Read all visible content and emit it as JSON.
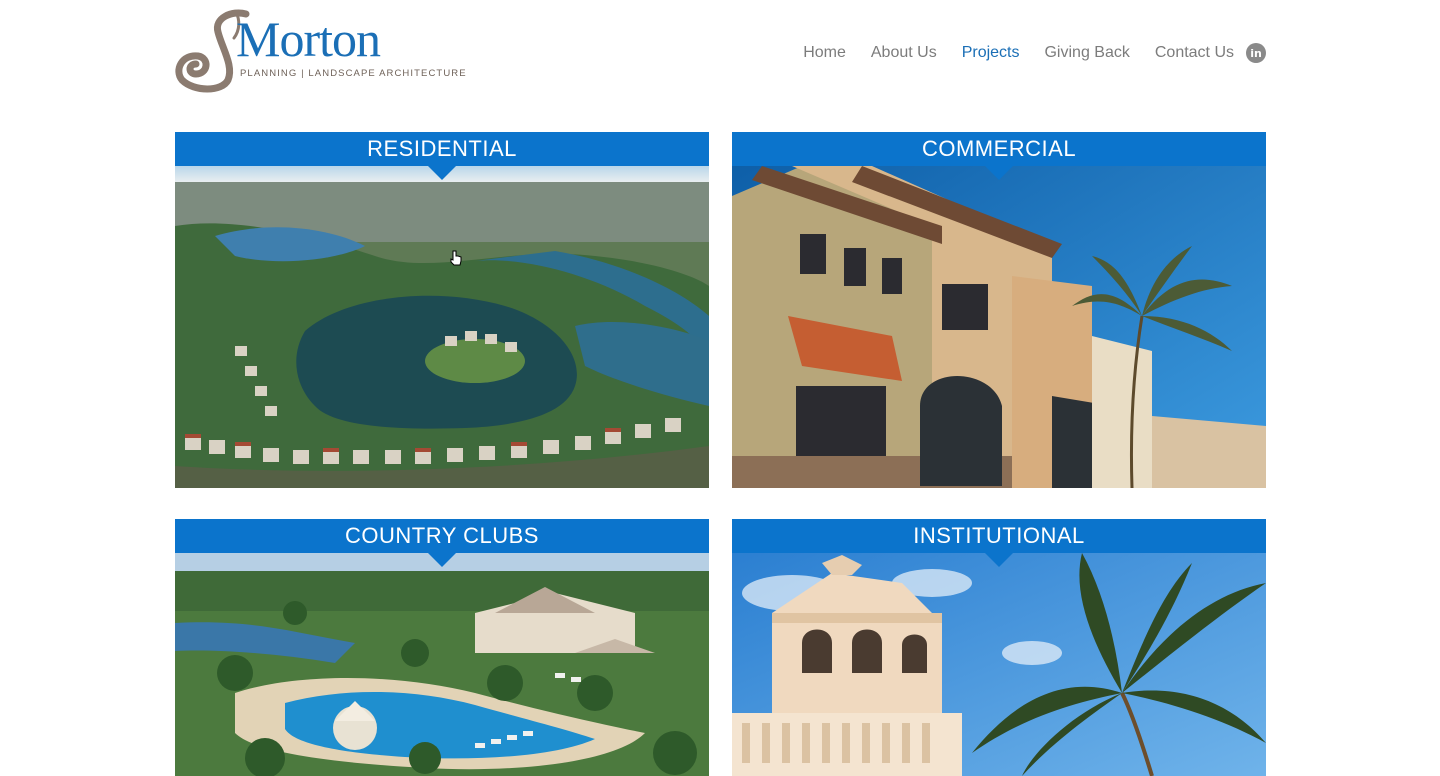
{
  "header": {
    "logo": {
      "wordmark": "Morton",
      "tagline": "PLANNING | LANDSCAPE ARCHITECTURE",
      "monogram": "J"
    },
    "nav": [
      {
        "label": "Home",
        "active": false
      },
      {
        "label": "About Us",
        "active": false
      },
      {
        "label": "Projects",
        "active": true
      },
      {
        "label": "Giving Back",
        "active": false
      },
      {
        "label": "Contact Us",
        "active": false
      }
    ],
    "social_icon": "linkedin-icon"
  },
  "projects": [
    {
      "title": "RESIDENTIAL",
      "image": "aerial-residential-lake-community"
    },
    {
      "title": "COMMERCIAL",
      "image": "mediterranean-commercial-building"
    },
    {
      "title": "COUNTRY CLUBS",
      "image": "country-club-pool-resort"
    },
    {
      "title": "INSTITUTIONAL",
      "image": "tower-and-palm-trees"
    }
  ],
  "colors": {
    "brand_blue": "#0b74cc",
    "nav_active": "#1b6fb6",
    "nav_text": "#7c7c7c"
  }
}
